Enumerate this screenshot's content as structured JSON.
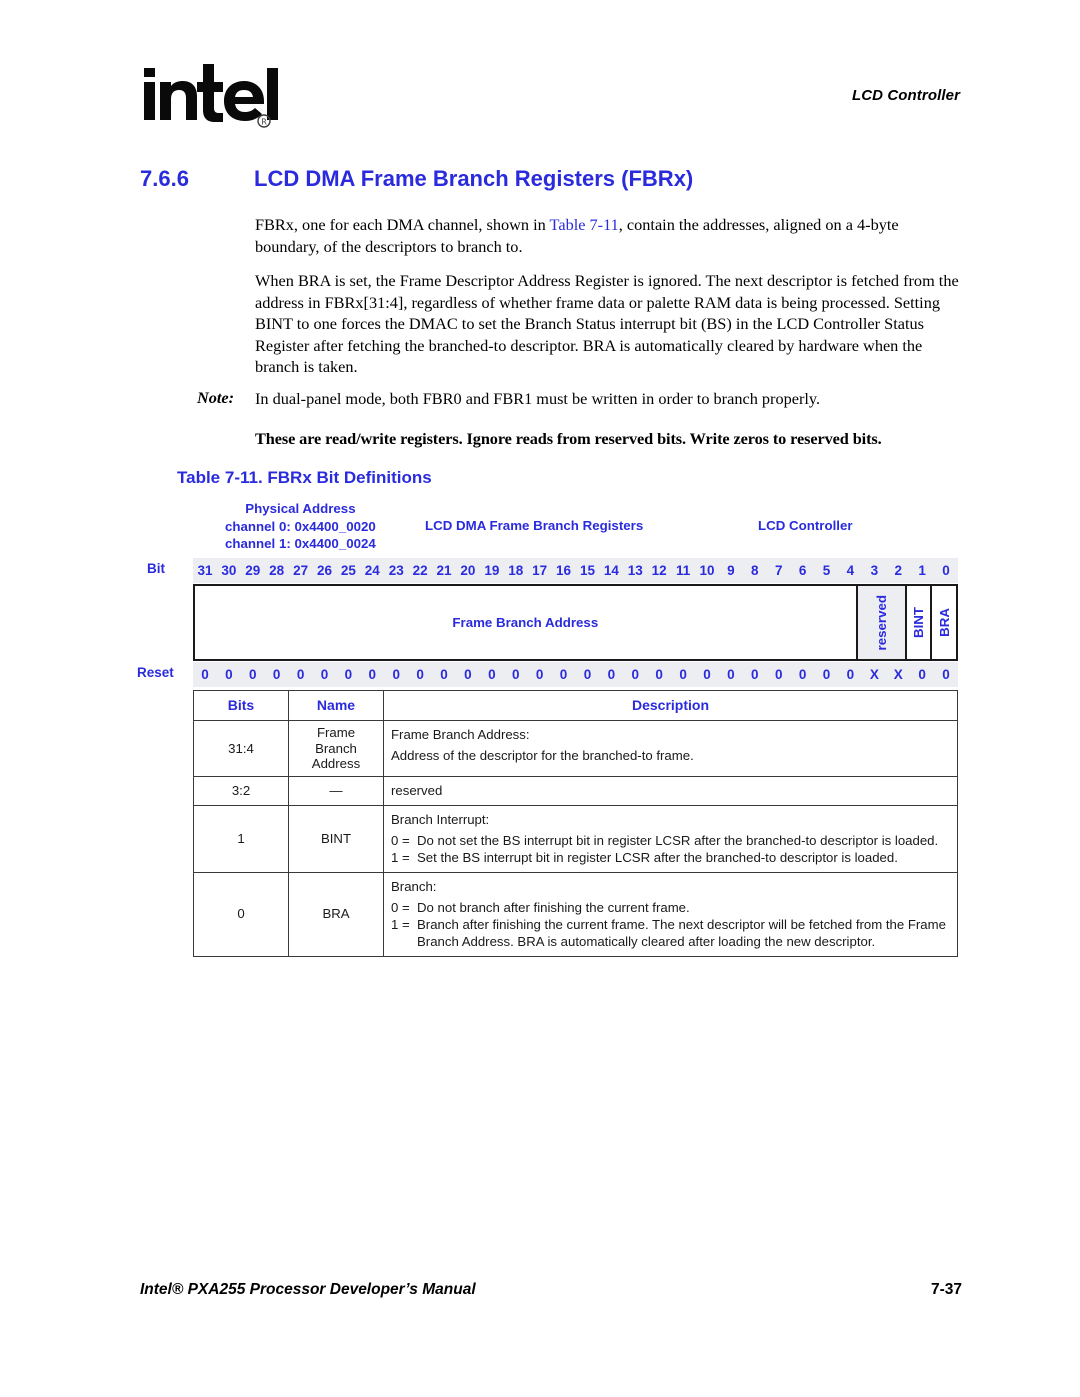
{
  "header": {
    "logo_text": "intel",
    "logo_mark": "registered-trademark",
    "chapter": "LCD Controller"
  },
  "section": {
    "number": "7.6.6",
    "title": "LCD DMA Frame Branch Registers (FBRx)"
  },
  "body": {
    "paragraph1_pre": "FBRx, one for each DMA channel, shown in ",
    "paragraph1_xref": "Table 7-11",
    "paragraph1_post": ", contain the addresses, aligned on a 4-byte boundary, of the descriptors to branch to.",
    "paragraph2": "When BRA is set, the Frame Descriptor Address Register is ignored. The next descriptor is fetched from the address in FBRx[31:4], regardless of whether frame data or palette RAM data is being processed. Setting BINT to one forces the DMAC to set the Branch Status interrupt bit (BS) in the LCD Controller Status Register after fetching the branched-to descriptor. BRA is automatically cleared by hardware when the branch is taken.",
    "note_label": "Note:",
    "note_text": "In dual-panel mode, both FBR0 and FBR1 must be written in order to branch properly.",
    "readwrite_statement": "These are read/write registers. Ignore reads from reserved bits. Write zeros to reserved bits."
  },
  "table_caption": "Table 7-11. FBRx Bit Definitions",
  "register_diagram": {
    "physical_address_label": "Physical Address",
    "channel0": "channel 0: 0x4400_0020",
    "channel1": "channel 1: 0x4400_0024",
    "register_name": "LCD DMA Frame Branch Registers",
    "unit_name": "LCD Controller",
    "bit_row_label": "Bit",
    "reset_row_label": "Reset",
    "bit_numbers": [
      "31",
      "30",
      "29",
      "28",
      "27",
      "26",
      "25",
      "24",
      "23",
      "22",
      "21",
      "20",
      "19",
      "18",
      "17",
      "16",
      "15",
      "14",
      "13",
      "12",
      "11",
      "10",
      "9",
      "8",
      "7",
      "6",
      "5",
      "4",
      "3",
      "2",
      "1",
      "0"
    ],
    "reset_values": [
      "0",
      "0",
      "0",
      "0",
      "0",
      "0",
      "0",
      "0",
      "0",
      "0",
      "0",
      "0",
      "0",
      "0",
      "0",
      "0",
      "0",
      "0",
      "0",
      "0",
      "0",
      "0",
      "0",
      "0",
      "0",
      "0",
      "0",
      "0",
      "X",
      "X",
      "0",
      "0"
    ],
    "fields": [
      {
        "label": "Frame Branch Address",
        "span": 28,
        "orientation": "horizontal",
        "shaded": false
      },
      {
        "label": "reserved",
        "span": 2,
        "orientation": "vertical",
        "shaded": true
      },
      {
        "label": "BINT",
        "span": 1,
        "orientation": "vertical",
        "shaded": false
      },
      {
        "label": "BRA",
        "span": 1,
        "orientation": "vertical",
        "shaded": false
      }
    ]
  },
  "bit_table": {
    "columns": [
      "Bits",
      "Name",
      "Description"
    ],
    "rows": [
      {
        "bits": "31:4",
        "name": "Frame\nBranch\nAddress",
        "desc_title": "Frame Branch Address:",
        "desc_body": "Address of the descriptor for the branched-to frame.",
        "options": []
      },
      {
        "bits": "3:2",
        "name": "—",
        "desc_title": "reserved",
        "desc_body": "",
        "options": []
      },
      {
        "bits": "1",
        "name": "BINT",
        "desc_title": "Branch Interrupt:",
        "desc_body": "",
        "options": [
          {
            "key": "0 =",
            "value": "Do not set the BS interrupt bit in register LCSR after the branched-to descriptor is loaded."
          },
          {
            "key": "1 =",
            "value": "Set the BS interrupt bit in register LCSR after the branched-to descriptor is loaded."
          }
        ]
      },
      {
        "bits": "0",
        "name": "BRA",
        "desc_title": "Branch:",
        "desc_body": "",
        "options": [
          {
            "key": "0 =",
            "value": "Do not branch after finishing the current frame."
          },
          {
            "key": "1 =",
            "value": "Branch after finishing the current frame. The next descriptor will be fetched from the Frame Branch Address. BRA is automatically cleared after loading the new descriptor."
          }
        ]
      }
    ]
  },
  "footer": {
    "left": "Intel® PXA255 Processor Developer’s Manual",
    "right": "7-37"
  },
  "colors": {
    "accent_blue": "#2b2bde",
    "shade_gray": "#edeef2",
    "rule_dark": "#1a1a1a"
  }
}
